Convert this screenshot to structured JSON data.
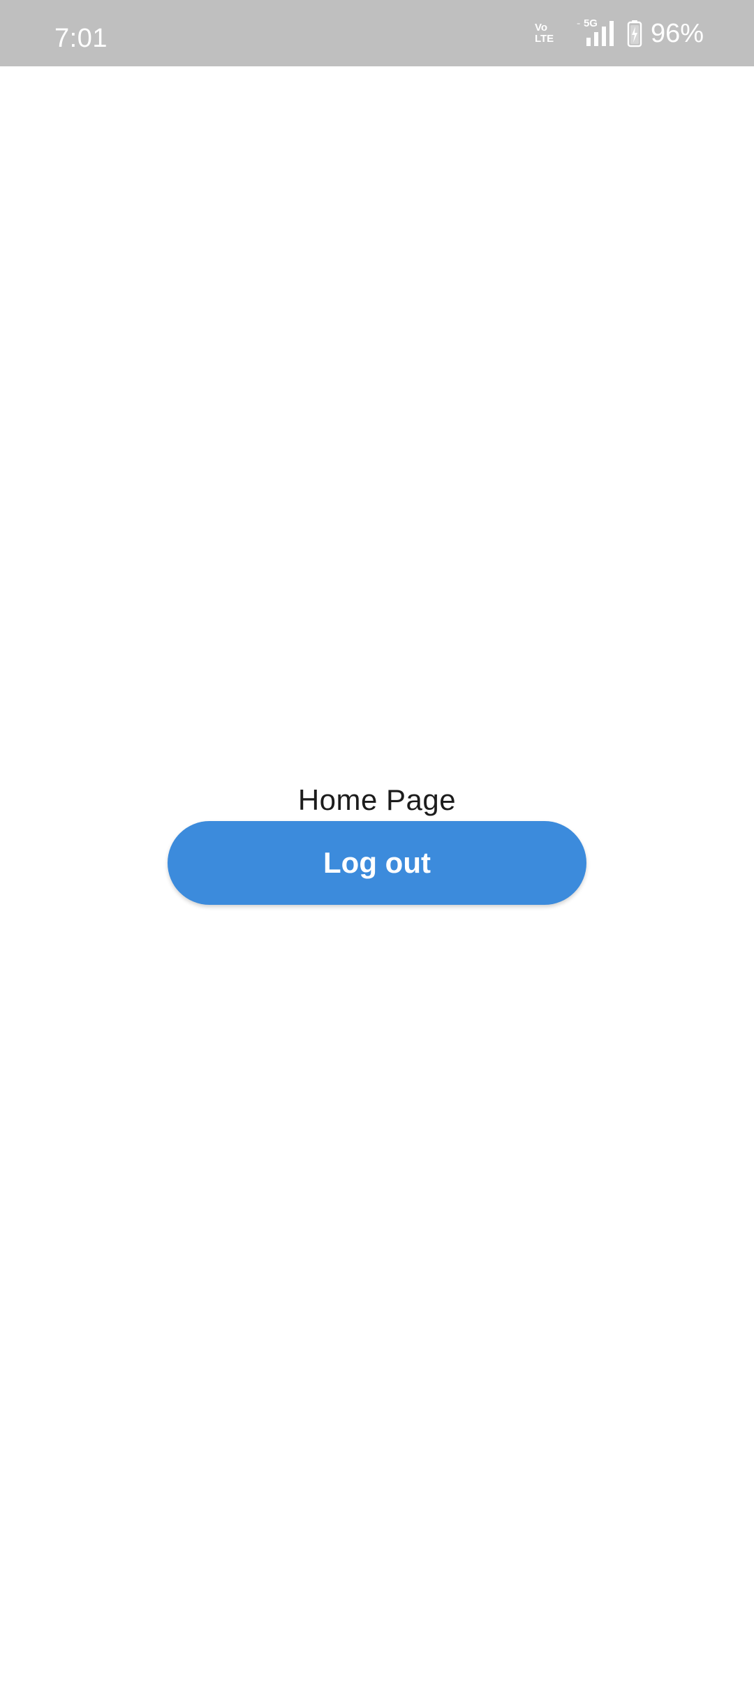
{
  "status_bar": {
    "time": "7:01",
    "volte_top": "Vo",
    "volte_bottom": "LTE",
    "network": "5G",
    "battery_percent": "96%",
    "icons": [
      "volte-icon",
      "signal-icon",
      "battery-charging-icon"
    ]
  },
  "main": {
    "title": "Home Page",
    "logout_label": "Log out"
  },
  "colors": {
    "status_bar_bg": "#bfbfbf",
    "button_bg": "#3c8bdc",
    "button_text": "#ffffff",
    "title_text": "#1c1c1c",
    "page_bg": "#ffffff"
  }
}
